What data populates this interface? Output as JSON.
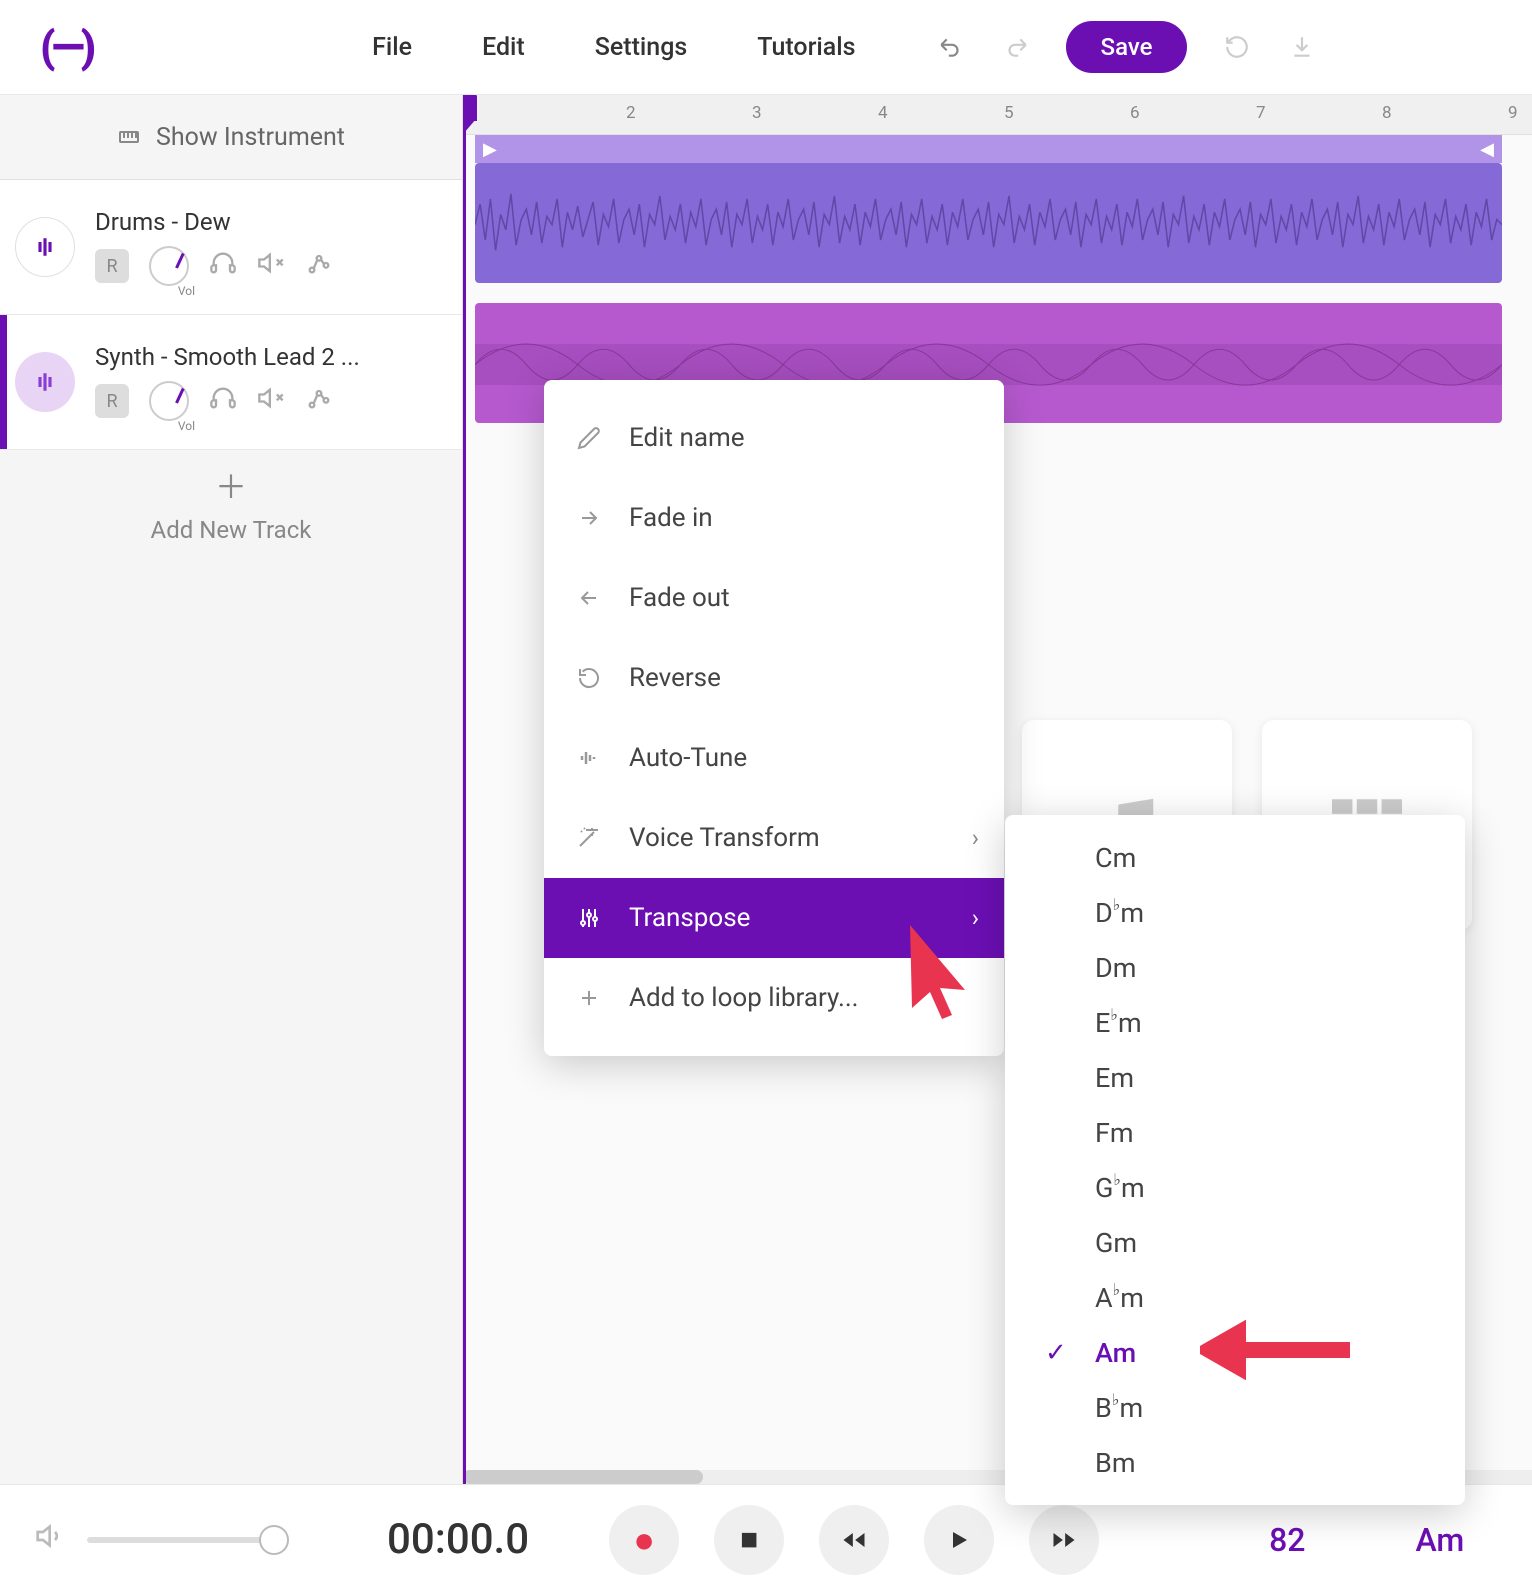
{
  "header": {
    "menu": [
      "File",
      "Edit",
      "Settings",
      "Tutorials"
    ],
    "save_label": "Save"
  },
  "sidebar": {
    "show_instrument_label": "Show Instrument",
    "tracks": [
      {
        "name": "Drums - Dew",
        "vol_label": "Vol",
        "r_label": "R"
      },
      {
        "name": "Synth - Smooth Lead 2 ...",
        "vol_label": "Vol",
        "r_label": "R"
      }
    ],
    "add_track_label": "Add New Track"
  },
  "ruler": {
    "marks": [
      "2",
      "3",
      "4",
      "5",
      "6",
      "7",
      "8",
      "9"
    ]
  },
  "context_menu": {
    "items": [
      {
        "label": "Edit name",
        "icon": "pencil"
      },
      {
        "label": "Fade in",
        "icon": "arrow-right"
      },
      {
        "label": "Fade out",
        "icon": "arrow-left"
      },
      {
        "label": "Reverse",
        "icon": "reverse"
      },
      {
        "label": "Auto-Tune",
        "icon": "bars"
      },
      {
        "label": "Voice Transform",
        "icon": "wand",
        "submenu": true
      },
      {
        "label": "Transpose",
        "icon": "sliders",
        "submenu": true,
        "active": true
      },
      {
        "label": "Add to loop library...",
        "icon": "plus"
      }
    ]
  },
  "transpose_submenu": {
    "items": [
      "Cm",
      "D♭m",
      "Dm",
      "E♭m",
      "Em",
      "Fm",
      "G♭m",
      "Gm",
      "A♭m",
      "Am",
      "B♭m",
      "Bm"
    ],
    "selected": "Am"
  },
  "transport": {
    "time": "00:00.0",
    "bpm": "82",
    "key": "Am"
  }
}
